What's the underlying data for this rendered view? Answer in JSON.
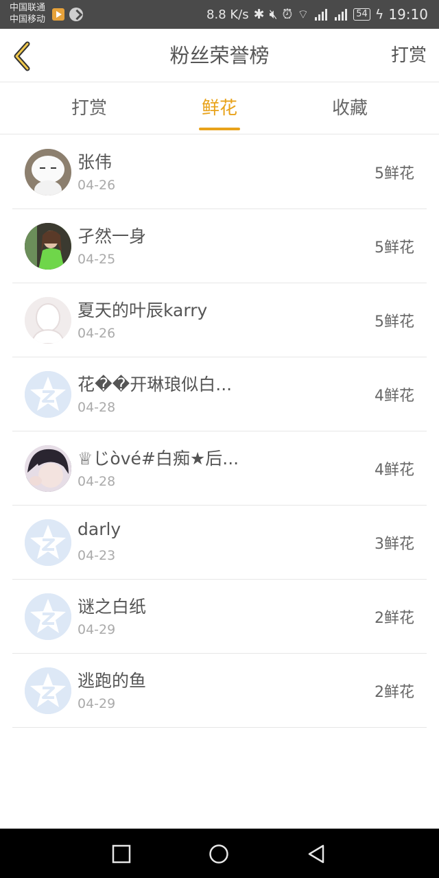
{
  "status_bar": {
    "carrier1": "中国联通",
    "carrier2": "中国移动",
    "speed": "8.8 K/s",
    "battery": "54",
    "time": "19:10",
    "signal1_label": "3G",
    "signal2_label": "4G"
  },
  "header": {
    "title": "粉丝荣誉榜",
    "right_action": "打赏"
  },
  "tabs": [
    {
      "label": "打赏",
      "active": false
    },
    {
      "label": "鲜花",
      "active": true
    },
    {
      "label": "收藏",
      "active": false
    }
  ],
  "accent_color": "#e8a21a",
  "list": [
    {
      "name": "张伟",
      "date": "04-26",
      "amount": "5鲜花",
      "avatar": "white-character"
    },
    {
      "name": "孑然一身",
      "date": "04-25",
      "amount": "5鲜花",
      "avatar": "photo-girl-green"
    },
    {
      "name": "夏天的叶辰karry",
      "date": "04-26",
      "amount": "5鲜花",
      "avatar": "ghost-silhouette"
    },
    {
      "name": "花��开琳琅似白...",
      "date": "04-28",
      "amount": "4鲜花",
      "avatar": "default-star"
    },
    {
      "name": "♕じòvé#白痴★后...",
      "date": "04-28",
      "amount": "4鲜花",
      "avatar": "photo-person"
    },
    {
      "name": "darly",
      "date": "04-23",
      "amount": "3鲜花",
      "avatar": "default-star"
    },
    {
      "name": "谜之白纸",
      "date": "04-29",
      "amount": "2鲜花",
      "avatar": "default-star"
    },
    {
      "name": "逃跑的鱼",
      "date": "04-29",
      "amount": "2鲜花",
      "avatar": "default-star"
    }
  ]
}
